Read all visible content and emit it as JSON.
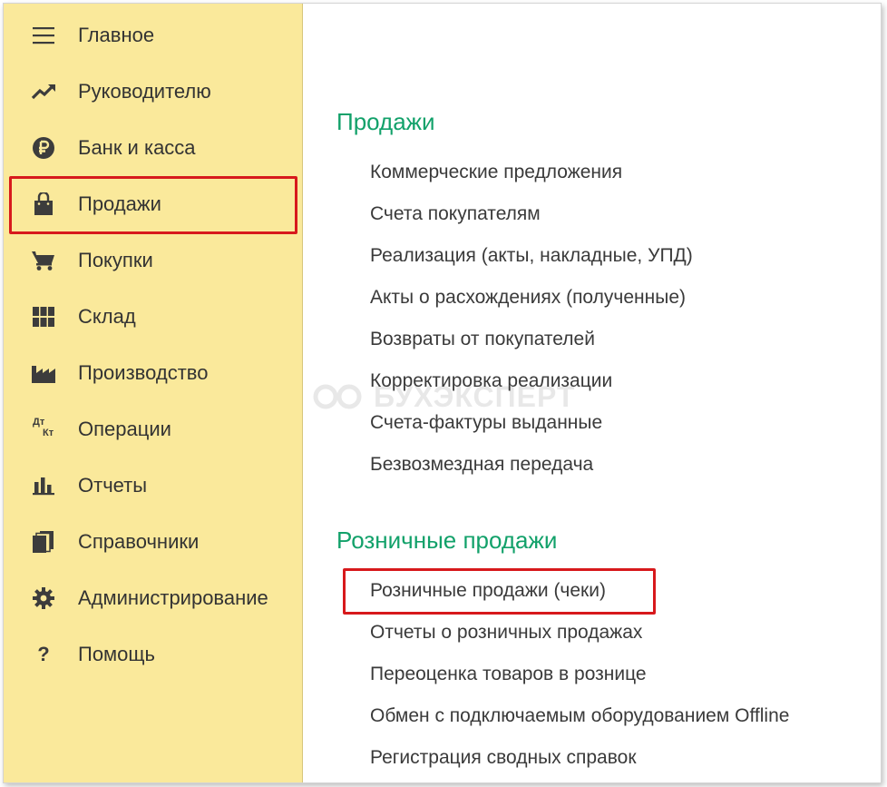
{
  "sidebar": {
    "items": [
      {
        "label": "Главное",
        "icon": "menu-icon"
      },
      {
        "label": "Руководителю",
        "icon": "trend-chart-icon"
      },
      {
        "label": "Банк и касса",
        "icon": "ruble-coin-icon"
      },
      {
        "label": "Продажи",
        "icon": "shopping-bag-icon",
        "highlighted": true
      },
      {
        "label": "Покупки",
        "icon": "shopping-cart-icon"
      },
      {
        "label": "Склад",
        "icon": "warehouse-grid-icon"
      },
      {
        "label": "Производство",
        "icon": "factory-icon"
      },
      {
        "label": "Операции",
        "icon": "dt-kt-icon",
        "icon_text": [
          "Дт",
          "Кт"
        ]
      },
      {
        "label": "Отчеты",
        "icon": "bar-chart-icon"
      },
      {
        "label": "Справочники",
        "icon": "books-icon"
      },
      {
        "label": "Администрирование",
        "icon": "gear-icon"
      },
      {
        "label": "Помощь",
        "icon": "help-icon",
        "icon_text": "?"
      }
    ]
  },
  "main": {
    "sections": [
      {
        "title": "Продажи",
        "links": [
          "Коммерческие предложения",
          "Счета покупателям",
          "Реализация (акты, накладные, УПД)",
          "Акты о расхождениях (полученные)",
          "Возвраты от покупателей",
          "Корректировка реализации",
          "Счета-фактуры выданные",
          "Безвозмездная передача"
        ]
      },
      {
        "title": "Розничные продажи",
        "links": [
          "Розничные продажи (чеки)",
          "Отчеты о розничных продажах",
          "Переоценка товаров в рознице",
          "Обмен с подключаемым оборудованием Offline",
          "Регистрация сводных справок"
        ],
        "highlighted_link": "Розничные продажи (чеки)"
      }
    ]
  },
  "watermark": {
    "text": "БУХЭКСПЕРТ"
  },
  "colors": {
    "sidebar_bg": "#fae99b",
    "section_title": "#12a16a",
    "highlight_border": "#d7191c",
    "text": "#333333"
  }
}
